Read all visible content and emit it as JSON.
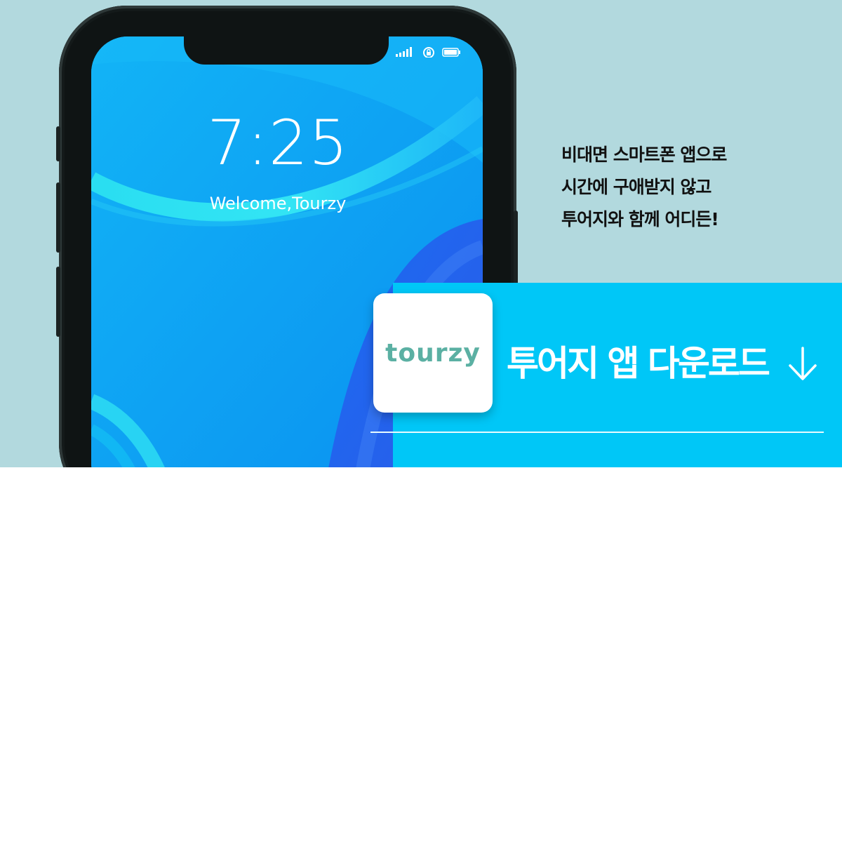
{
  "phone": {
    "time": "7:25",
    "greeting": "Welcome,Tourzy",
    "status_icons": [
      "signal-icon",
      "rotation-lock-icon",
      "battery-icon"
    ]
  },
  "tagline": {
    "lines": [
      "비대면 스마트폰 앱으로",
      "시간에 구애받지 않고",
      "투어지와 함께 어디든!"
    ]
  },
  "cta": {
    "logo_text": "tourzy",
    "label": "투어지 앱 다운로드",
    "icon": "arrow-down-icon"
  },
  "colors": {
    "background": "#b2d9de",
    "accent": "#00c7f7",
    "logo": "#5bb0a3"
  }
}
